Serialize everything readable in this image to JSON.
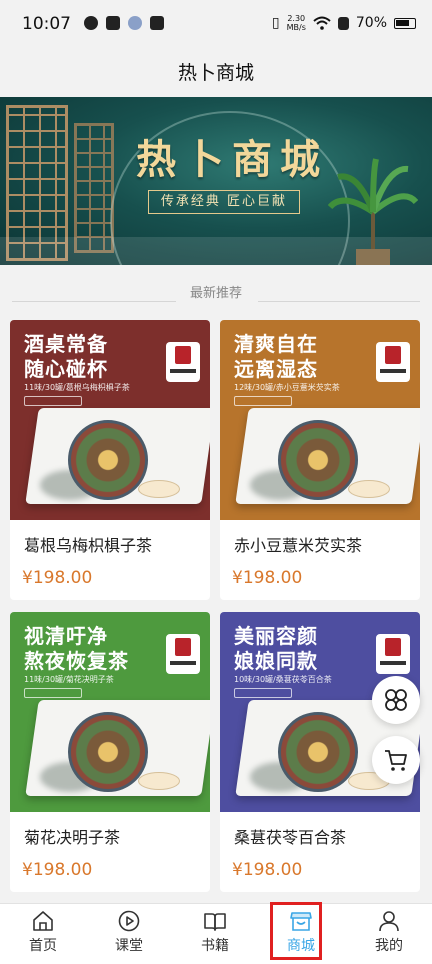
{
  "status_bar": {
    "time": "10:07",
    "net_speed_value": "2.30",
    "net_speed_unit": "MB/s",
    "battery": "70%"
  },
  "header": {
    "title": "热卜商城"
  },
  "banner": {
    "title": "热卜商城",
    "slogan": "传承经典 匠心巨献"
  },
  "section": {
    "title": "最新推荐"
  },
  "products": [
    {
      "name": "葛根乌梅枳椇子茶",
      "price": "¥198.00",
      "poster_line1": "酒桌常备",
      "poster_line2": "随心碰杯",
      "poster_sub": "11味/30罐/葛根乌梅枳椇子茶",
      "color": "#7d2f2c"
    },
    {
      "name": "赤小豆薏米芡实茶",
      "price": "¥198.00",
      "poster_line1": "清爽自在",
      "poster_line2": "远离湿态",
      "poster_sub": "12味/30罐/赤小豆薏米芡实茶",
      "color": "#b7742c"
    },
    {
      "name": "菊花决明子茶",
      "price": "¥198.00",
      "poster_line1": "视清吁净",
      "poster_line2": "熬夜恢复茶",
      "poster_sub": "11味/30罐/菊花决明子茶",
      "color": "#4e9a3e"
    },
    {
      "name": "桑葚茯苓百合茶",
      "price": "¥198.00",
      "poster_line1": "美丽容颜",
      "poster_line2": "娘娘同款",
      "poster_sub": "10味/30罐/桑葚茯苓百合茶",
      "color": "#4e4ea0"
    }
  ],
  "bottom_nav": {
    "items": [
      {
        "label": "首页",
        "icon": "home-icon"
      },
      {
        "label": "课堂",
        "icon": "play-circle-icon"
      },
      {
        "label": "书籍",
        "icon": "book-icon"
      },
      {
        "label": "商城",
        "icon": "store-icon",
        "active": true
      },
      {
        "label": "我的",
        "icon": "person-icon"
      }
    ],
    "active_color": "#3aa6e6"
  },
  "floating": {
    "menu_icon": "grid-flower-icon",
    "cart_icon": "cart-icon"
  }
}
